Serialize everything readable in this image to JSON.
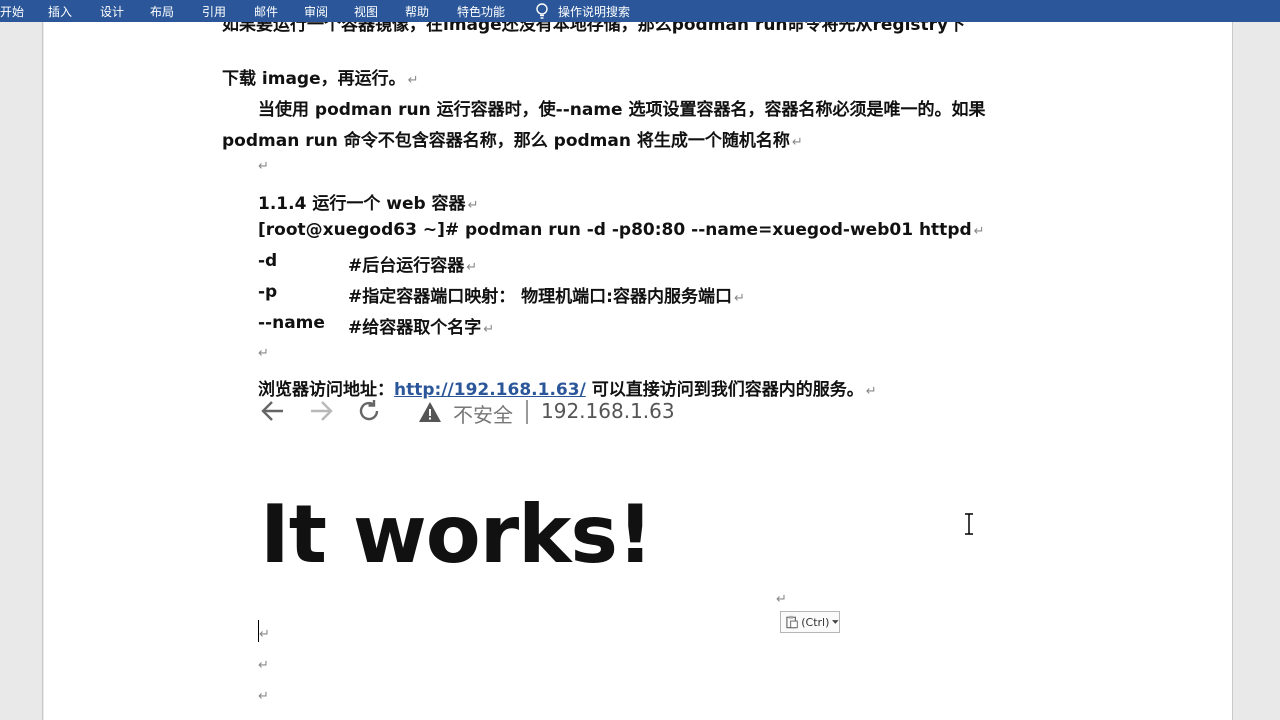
{
  "ribbon": {
    "tabs": [
      "开始",
      "插入",
      "设计",
      "布局",
      "引用",
      "邮件",
      "审阅",
      "视图",
      "帮助",
      "特色功能"
    ],
    "tell_me": "操作说明搜索"
  },
  "doc": {
    "para_cut": "如果要运行一个容器镜像，在image还没有本地存储，那么podman run命令将先从registry下",
    "para1_end": "下载 image，再运行。",
    "para2_line1": "当使用 podman run 运行容器时，使--name 选项设置容器名，容器名称必须是唯一的。如果",
    "para2_line2": "podman run 命令不包含容器名称，那么 podman 将生成一个随机名称",
    "heading": "1.1.4   运行一个 web 容器",
    "command": "[root@xuegod63 ~]# podman run -d -p80:80 --name=xuegod-web01 httpd",
    "options": [
      {
        "flag": "-d",
        "desc": "#后台运行容器"
      },
      {
        "flag": "-p",
        "desc": "#指定容器端口映射：    物理机端口:容器内服务端口"
      },
      {
        "flag": "--name",
        "desc": "#给容器取个名字"
      }
    ],
    "browser_label": "浏览器访问地址：",
    "browser_url": "http://192.168.1.63/",
    "browser_after": "可以直接访问到我们容器内的服务。",
    "paragraph_mark": "↵"
  },
  "browser": {
    "insecure_label": "不安全",
    "address": "192.168.1.63",
    "page_heading": "It works!"
  },
  "paste_options": {
    "label": "(Ctrl)"
  }
}
